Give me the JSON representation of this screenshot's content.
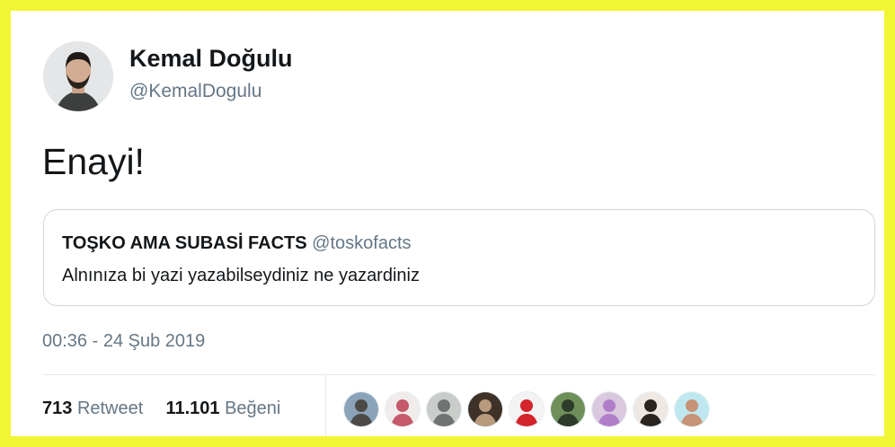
{
  "author": {
    "name": "Kemal Doğulu",
    "handle": "@KemalDogulu"
  },
  "tweet": {
    "text": "Enayi!",
    "timestamp": "00:36 - 24 Şub 2019"
  },
  "quoted_tweet": {
    "name": "TOŞKO AMA SUBASİ FACTS",
    "handle": "@toskofacts",
    "text": "Alnınıza bi yazi yazabilseydiniz ne yazardiniz"
  },
  "stats": {
    "retweets_count": "713",
    "retweets_label": "Retweet",
    "likes_count": "11.101",
    "likes_label": "Beğeni"
  },
  "likers": [
    {
      "icon": "liker-avatar",
      "bg": "#8aa3b8",
      "fg": "#4b4a47"
    },
    {
      "icon": "liker-avatar",
      "bg": "#f1ecec",
      "fg": "#c45a6a"
    },
    {
      "icon": "liker-avatar",
      "bg": "#c9ccc9",
      "fg": "#6f7371"
    },
    {
      "icon": "liker-avatar",
      "bg": "#3e3228",
      "fg": "#b89a7c"
    },
    {
      "icon": "liker-avatar",
      "bg": "#f3f3f3",
      "fg": "#d3232b"
    },
    {
      "icon": "liker-avatar",
      "bg": "#6f8f5a",
      "fg": "#2c3b2a"
    },
    {
      "icon": "liker-avatar",
      "bg": "#d9c8de",
      "fg": "#b07ec9"
    },
    {
      "icon": "liker-avatar",
      "bg": "#eee7e2",
      "fg": "#2a2421"
    },
    {
      "icon": "liker-avatar",
      "bg": "#bfe7f0",
      "fg": "#c79276"
    }
  ],
  "colors": {
    "frame": "#f2f534",
    "text_primary": "#14171a",
    "text_secondary": "#657786",
    "border": "#ccd6dd"
  }
}
